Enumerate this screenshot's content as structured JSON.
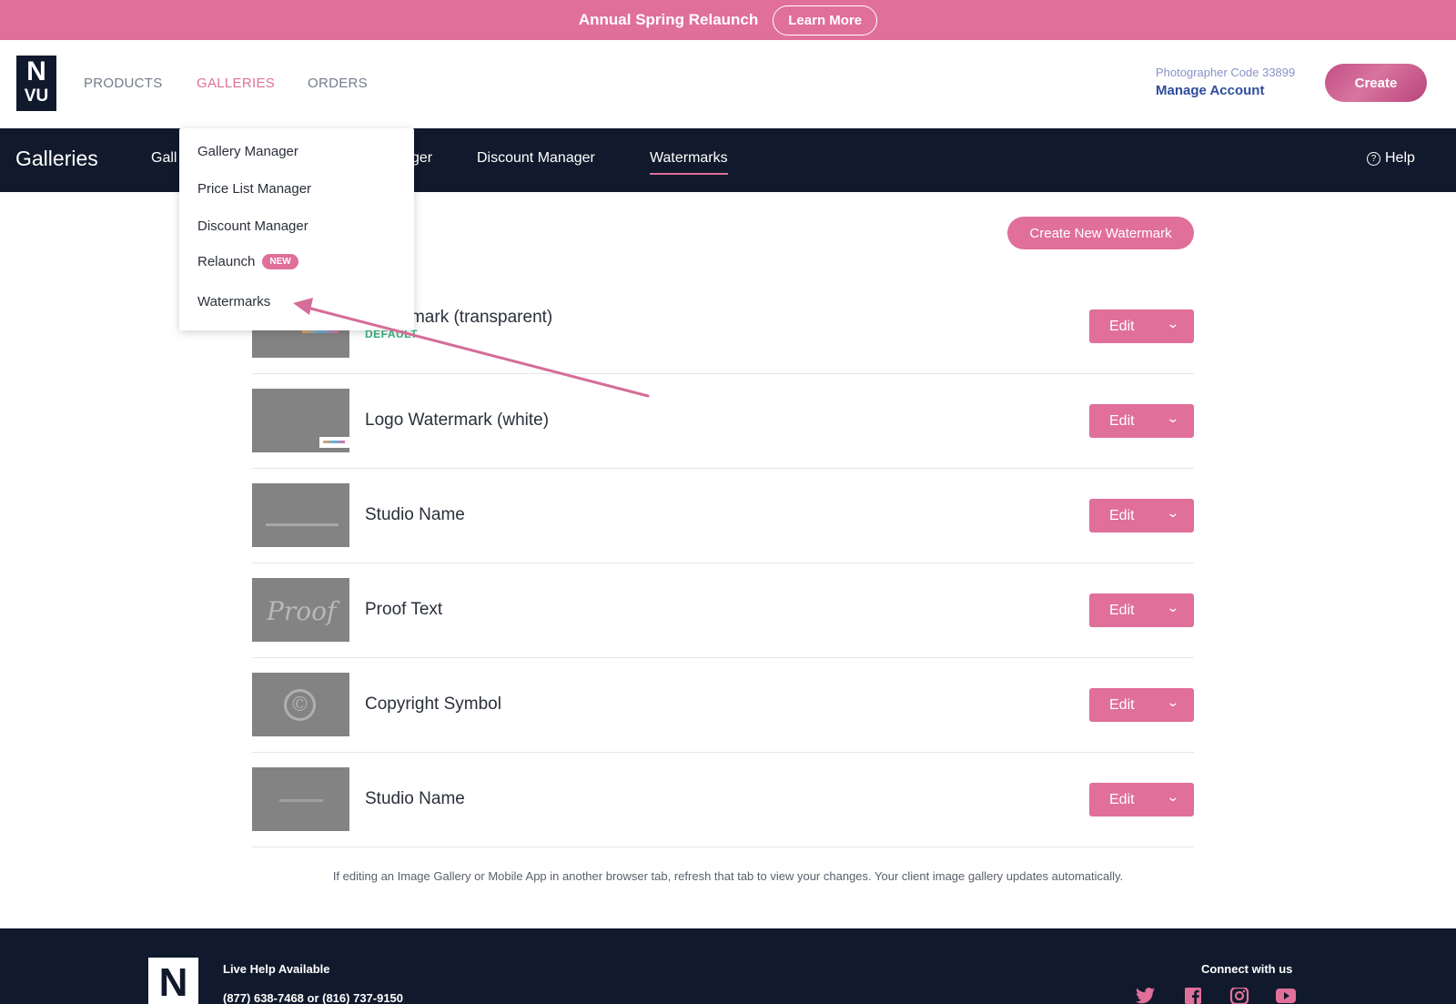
{
  "promo": {
    "text": "Annual Spring Relaunch",
    "button": "Learn More"
  },
  "logo": {
    "line1": "N",
    "line2": "VU"
  },
  "nav": {
    "products": "PRODUCTS",
    "galleries": "GALLERIES",
    "orders": "ORDERS"
  },
  "account": {
    "photographer_code": "Photographer Code 33899",
    "manage": "Manage Account",
    "create": "Create"
  },
  "subnav": {
    "title": "Galleries",
    "items": [
      "Gall",
      "ger",
      "Discount Manager",
      "Watermarks"
    ],
    "active": "Watermarks",
    "help": "Help"
  },
  "dropdown": {
    "items": [
      "Gallery Manager",
      "Price List Manager",
      "Discount Manager",
      "Relaunch",
      "Watermarks"
    ],
    "new_badge": "NEW"
  },
  "create_new_watermark": "Create New Watermark",
  "watermarks": [
    {
      "name": "Watermark (transparent)",
      "badge": "DEFAULT",
      "thumb": "color-logo"
    },
    {
      "name": "Logo Watermark (white)",
      "thumb": "white-logo"
    },
    {
      "name": "Studio Name",
      "thumb": "tiny-text"
    },
    {
      "name": "Proof Text",
      "thumb": "proof",
      "thumb_text": "Proof"
    },
    {
      "name": "Copyright Symbol",
      "thumb": "copyright",
      "thumb_text": "©"
    },
    {
      "name": "Studio Name",
      "thumb": "tiny-text-2"
    }
  ],
  "edit_label": "Edit",
  "notice": "If editing an Image Gallery or Mobile App in another browser tab, refresh that tab to view your changes. Your client image gallery updates automatically.",
  "footer": {
    "live_help": "Live Help Available",
    "phones": "(877) 638-7468 or (816) 737-9150",
    "connect": "Connect with us",
    "logo_letter": "N",
    "social_icons": [
      "twitter-icon",
      "facebook-icon",
      "instagram-icon",
      "youtube-icon"
    ]
  },
  "colors": {
    "accent": "#e06f9a",
    "navy": "#101a2c",
    "default_green": "#36b37e"
  }
}
